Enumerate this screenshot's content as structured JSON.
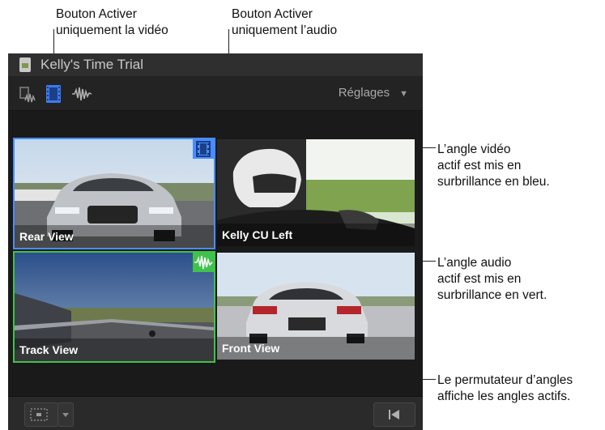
{
  "callouts": {
    "video_only": [
      "Bouton Activer",
      "uniquement la vidéo"
    ],
    "audio_only": [
      "Bouton Activer",
      "uniquement l’audio"
    ],
    "video_angle": [
      "L’angle vidéo",
      "actif est mis en",
      "surbrillance en bleu."
    ],
    "audio_angle": [
      "L’angle audio",
      "actif est mis en",
      "surbrillance en vert."
    ],
    "switcher": [
      "Le permutateur d’angles",
      "affiche les angles actifs."
    ]
  },
  "window": {
    "title": "Kelly's Time Trial"
  },
  "toolbar": {
    "settings_label": "Réglages",
    "buttons": [
      {
        "icon": "video-audio-icon",
        "active": false
      },
      {
        "icon": "film-icon",
        "active": true
      },
      {
        "icon": "waveform-icon",
        "active": false
      }
    ]
  },
  "angles": [
    {
      "label": "Rear View",
      "highlight": "video"
    },
    {
      "label": "Kelly CU Left",
      "highlight": "none"
    },
    {
      "label": "Track View",
      "highlight": "audio"
    },
    {
      "label": "Front View",
      "highlight": "none"
    }
  ],
  "colors": {
    "video_highlight": "#4a8cff",
    "audio_highlight": "#3fc24a",
    "switcher_blue": "#3b82e6",
    "switcher_green": "#35b34a",
    "switcher_gray": "#9a9a9a"
  }
}
